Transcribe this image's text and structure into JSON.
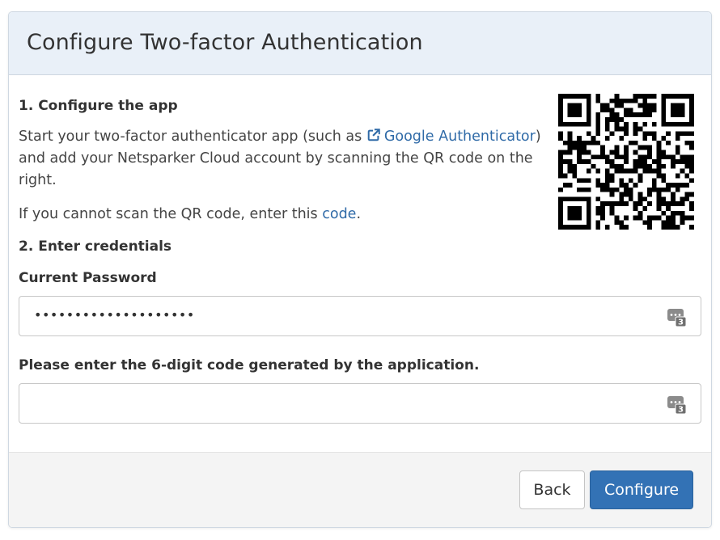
{
  "modal": {
    "title": "Configure Two-factor Authentication",
    "step1_heading": "1. Configure the app",
    "description": {
      "prefix": "Start your two-factor authenticator app (such as ",
      "link_line1": "Google",
      "link_line2": "Authenticator",
      "suffix": ") and add your Netsparker Cloud account by scanning the QR code on the right."
    },
    "cannot_scan": {
      "prefix": "If you cannot scan the QR code, enter this ",
      "link": "code",
      "suffix": "."
    },
    "qr_icon": "qr-code",
    "external_link_icon": "external-link-icon",
    "step2_heading": "2. Enter credentials",
    "password": {
      "label": "Current Password",
      "value": "••••••••••••••••••••",
      "icon": "password-manager-icon"
    },
    "code": {
      "label": "Please enter the 6-digit code generated by the application.",
      "value": "",
      "placeholder": "",
      "icon": "password-manager-icon"
    }
  },
  "footer": {
    "back_label": "Back",
    "configure_label": "Configure"
  },
  "colors": {
    "header_bg": "#e9f0f8",
    "link": "#2f6aa7",
    "primary_button": "#3372b5",
    "footer_bg": "#f4f4f4"
  }
}
